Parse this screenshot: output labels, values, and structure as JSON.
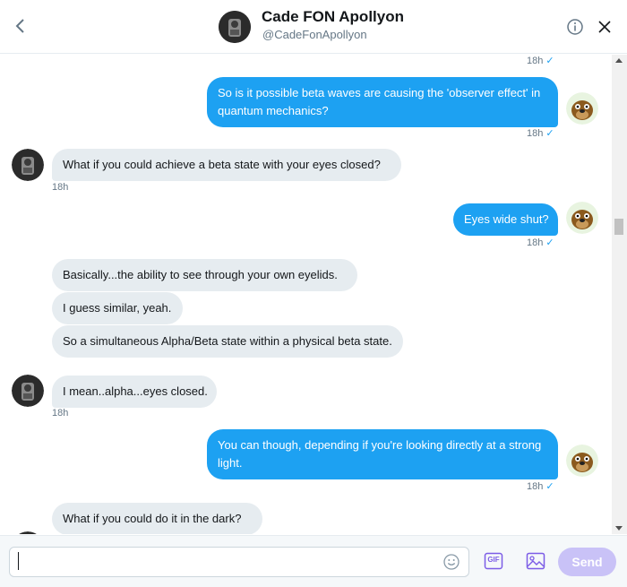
{
  "header": {
    "name": "Cade FON Apollyon",
    "handle": "@CadeFonApollyon",
    "back_icon": "chevron-left-icon",
    "info_icon": "info-circle-icon",
    "close_icon": "close-icon"
  },
  "colors": {
    "outgoing_bubble": "#1da1f2",
    "incoming_bubble": "#e6ecf0",
    "send_button_disabled": "#c9c2f7",
    "icon_accent": "#7c5ce6"
  },
  "messages": [
    {
      "direction": "out",
      "timestamp": "18h",
      "read_check": "✓"
    },
    {
      "direction": "out",
      "text": "So is it possible beta waves are causing the 'observer effect' in quantum mechanics?",
      "timestamp": "18h",
      "read_check": "✓"
    },
    {
      "direction": "in",
      "text": "What if you could achieve a beta state with your eyes closed?",
      "timestamp": "18h"
    },
    {
      "direction": "out",
      "text": "Eyes wide shut?",
      "timestamp": "18h",
      "read_check": "✓"
    },
    {
      "direction": "in",
      "text": "Basically...the ability to see through your own eyelids."
    },
    {
      "direction": "in",
      "text": "I guess similar, yeah."
    },
    {
      "direction": "in",
      "text": "So a simultaneous Alpha/Beta state within a physical beta state."
    },
    {
      "direction": "in",
      "text": "I mean..alpha...eyes closed.",
      "timestamp": "18h"
    },
    {
      "direction": "out",
      "text": "You can though, depending if you're looking directly at a strong light.",
      "timestamp": "18h",
      "read_check": "✓"
    },
    {
      "direction": "in",
      "text": "What if you could do it in the dark?"
    }
  ],
  "composer": {
    "input_value": "",
    "emoji_icon": "smiley-icon",
    "gif_label": "GIF",
    "media_icon": "image-icon",
    "send_label": "Send"
  }
}
